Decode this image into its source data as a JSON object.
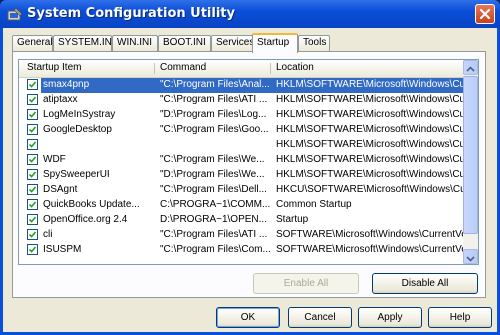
{
  "window": {
    "title": "System Configuration Utility"
  },
  "tabs": [
    {
      "label": "General"
    },
    {
      "label": "SYSTEM.INI"
    },
    {
      "label": "WIN.INI"
    },
    {
      "label": "BOOT.INI"
    },
    {
      "label": "Services"
    },
    {
      "label": "Startup",
      "active": true
    },
    {
      "label": "Tools"
    }
  ],
  "startup": {
    "columns": {
      "item": "Startup Item",
      "command": "Command",
      "location": "Location"
    },
    "rows": [
      {
        "checked": true,
        "item": "smax4pnp",
        "command": "\"C:\\Program Files\\Anal...",
        "location": "HKLM\\SOFTWARE\\Microsoft\\Windows\\CurrentVer...",
        "selected": true
      },
      {
        "checked": true,
        "item": "atiptaxx",
        "command": "\"C:\\Program Files\\ATI ...",
        "location": "HKLM\\SOFTWARE\\Microsoft\\Windows\\CurrentVer..."
      },
      {
        "checked": true,
        "item": "LogMeInSystray",
        "command": "\"D:\\Program Files\\Log...",
        "location": "HKLM\\SOFTWARE\\Microsoft\\Windows\\CurrentVer..."
      },
      {
        "checked": true,
        "item": "GoogleDesktop",
        "command": "\"C:\\Program Files\\Goo...",
        "location": "HKLM\\SOFTWARE\\Microsoft\\Windows\\CurrentVer..."
      },
      {
        "checked": true,
        "item": "",
        "command": "",
        "location": "HKLM\\SOFTWARE\\Microsoft\\Windows\\CurrentVer..."
      },
      {
        "checked": true,
        "item": "WDF",
        "command": "\"C:\\Program Files\\We...",
        "location": "HKLM\\SOFTWARE\\Microsoft\\Windows\\CurrentVer..."
      },
      {
        "checked": true,
        "item": "SpySweeperUI",
        "command": "\"D:\\Program Files\\We...",
        "location": "HKLM\\SOFTWARE\\Microsoft\\Windows\\CurrentVer..."
      },
      {
        "checked": true,
        "item": "DSAgnt",
        "command": "\"C:\\Program Files\\Dell...",
        "location": "HKCU\\SOFTWARE\\Microsoft\\Windows\\CurrentVer..."
      },
      {
        "checked": true,
        "item": "QuickBooks Update...",
        "command": "C:\\PROGRA~1\\COMM...",
        "location": "Common Startup"
      },
      {
        "checked": true,
        "item": "OpenOffice.org 2.4",
        "command": "D:\\PROGRA~1\\OPEN...",
        "location": "Startup"
      },
      {
        "checked": true,
        "item": "cli",
        "command": "\"C:\\Program Files\\ATI ...",
        "location": "SOFTWARE\\Microsoft\\Windows\\CurrentVersion\\Ru..."
      },
      {
        "checked": true,
        "item": "ISUSPM",
        "command": "\"C:\\Program Files\\Com...",
        "location": "SOFTWARE\\Microsoft\\Windows\\CurrentVersion\\Ru..."
      }
    ]
  },
  "buttons": {
    "enable_all": "Enable All",
    "disable_all": "Disable All",
    "ok": "OK",
    "cancel": "Cancel",
    "apply": "Apply",
    "help": "Help"
  },
  "icons": {
    "app": "system-config-icon",
    "close": "close-icon",
    "check": "checkmark-icon",
    "scroll_up": "arrow-up-icon",
    "scroll_down": "arrow-down-icon"
  },
  "colors": {
    "titlebar": "#0b4fd8",
    "selection": "#316ac5",
    "active_tab_accent": "#f1b83a",
    "checkbox_check": "#21a121",
    "close_button": "#d9532e"
  }
}
